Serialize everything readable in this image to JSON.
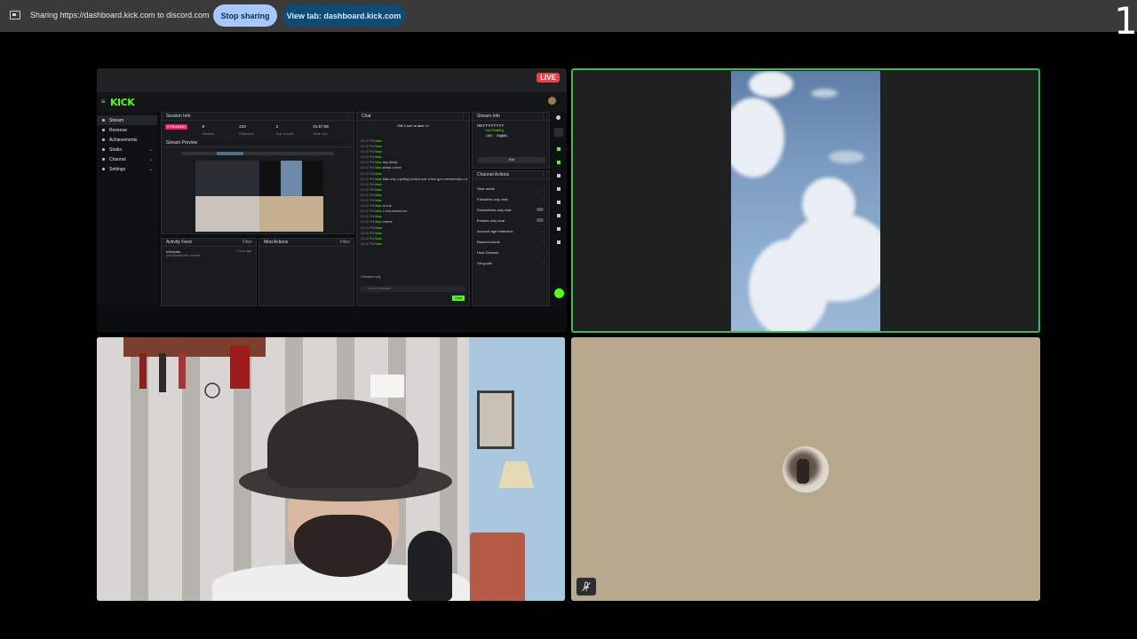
{
  "share_bar": {
    "sharing_text": "Sharing https://dashboard.kick.com to discord.com",
    "stop_label": "Stop sharing",
    "view_tab_label": "View tab: dashboard.kick.com",
    "page_number": "1"
  },
  "screen_share": {
    "live_label": "LIVE",
    "app": {
      "logo": "KICK",
      "sidebar": [
        {
          "label": "Stream",
          "active": true
        },
        {
          "label": "Revenue"
        },
        {
          "label": "Achievements"
        },
        {
          "label": "Studio",
          "chevron": "⌄"
        },
        {
          "label": "Channel",
          "chevron": "⌄"
        },
        {
          "label": "Settings",
          "chevron": "⌄"
        }
      ],
      "session": {
        "title": "Session Info",
        "status": "STREAMING",
        "stats": [
          {
            "value": "8",
            "label": "Viewers"
          },
          {
            "value": "219",
            "label": "Followers"
          },
          {
            "value": "2",
            "label": "Sub Counts"
          },
          {
            "value": "01:57:06",
            "label": "Time Live"
          }
        ]
      },
      "preview_title": "Stream Preview",
      "activity": {
        "title": "Activity Feed",
        "filter": "Filter",
        "user": "e4ehcats",
        "text": "just followed the channel",
        "time": "1 hour ago"
      },
      "mod_actions": {
        "title": "Mod Actions",
        "filter": "Filter"
      },
      "chat": {
        "title": "Chat",
        "gift_text": "Gift 1 sub to lace 'n!",
        "lines": [
          {
            "time": "01:12 PM",
            "user": "bliac",
            "msg": ""
          },
          {
            "time": "01:12 PM",
            "user": "bliac",
            "msg": ""
          },
          {
            "time": "01:12 PM",
            "user": "bliac",
            "msg": ""
          },
          {
            "time": "01:12 PM",
            "user": "bliac",
            "msg": ""
          },
          {
            "time": "01:12 PM",
            "user": "bliac",
            "msg": "hey daddy"
          },
          {
            "time": "01:12 PM",
            "user": "bliac",
            "msg": "whats u been"
          },
          {
            "time": "01:12 PM",
            "user": "bliac",
            "msg": ""
          },
          {
            "time": "01:12 PM",
            "user": "bliac",
            "msg": "bliac why u getting excited over a free gym membership u dont go gym"
          },
          {
            "time": "01:12 PM",
            "user": "bliac",
            "msg": ""
          },
          {
            "time": "01:12 PM",
            "user": "bliac",
            "msg": ""
          },
          {
            "time": "01:12 PM",
            "user": "bliac",
            "msg": ""
          },
          {
            "time": "01:12 PM",
            "user": "bliac",
            "msg": ""
          },
          {
            "time": "01:12 PM",
            "user": "bliac",
            "msg": "ai a ai"
          },
          {
            "time": "01:12 PM",
            "user": "bliac",
            "msg": "u look stoned rnn"
          },
          {
            "time": "01:12 PM",
            "user": "bliac",
            "msg": ""
          },
          {
            "time": "01:12 PM",
            "user": "bliac",
            "msg": "cheers"
          },
          {
            "time": "01:12 PM",
            "user": "bliac",
            "msg": ""
          },
          {
            "time": "01:12 PM",
            "user": "bliac",
            "msg": ""
          },
          {
            "time": "01:12 PM",
            "user": "bliac",
            "msg": ""
          },
          {
            "time": "01:12 PM",
            "user": "bliac",
            "msg": ""
          }
        ],
        "followers_only": "Followers only",
        "placeholder": "Send a message",
        "send": "Chat"
      },
      "stream_info": {
        "title": "Stream Info",
        "name": "HEYYYYYYYY",
        "category": "Just Chatting",
        "tags": [
          "18+",
          "English"
        ],
        "edit": "Edit"
      },
      "channel_actions": {
        "title": "Channel Actions",
        "items": [
          {
            "label": "Slow mode",
            "kind": "chev"
          },
          {
            "label": "Followers-only chat",
            "kind": "chev"
          },
          {
            "label": "Subscribers-only chat",
            "kind": "toggle"
          },
          {
            "label": "Emotes-only chat",
            "kind": "toggle"
          },
          {
            "label": "Account age restriction",
            "kind": "chev"
          },
          {
            "label": "Banned words",
            "kind": "chev"
          },
          {
            "label": "Host Channel",
            "kind": "none"
          },
          {
            "label": "Set goals",
            "kind": "chev"
          }
        ]
      }
    }
  },
  "colors": {
    "accent_green": "#53fc18",
    "live_red": "#ed4245",
    "speaking_border": "#3dbb5a",
    "stop_button": "#a8c7fa",
    "view_button": "#0f4c75"
  },
  "icons": {
    "share": "screen-share-icon",
    "muted": "mic-muted-icon"
  }
}
